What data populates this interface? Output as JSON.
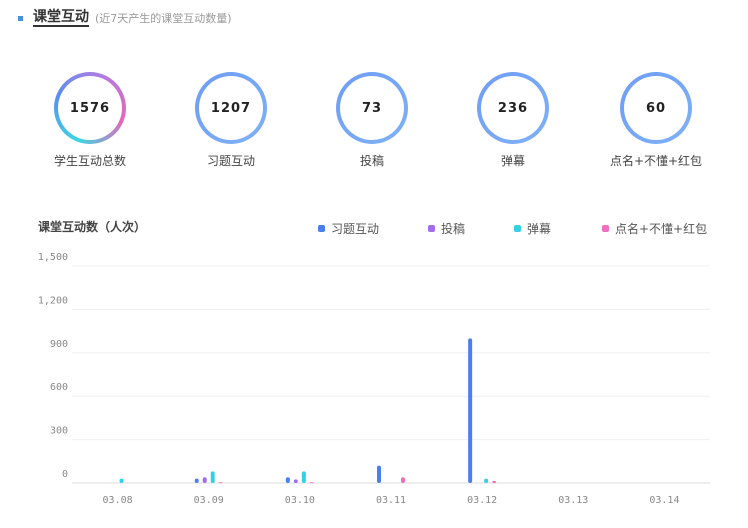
{
  "header": {
    "title": "课堂互动",
    "subtitle": "(近7天产生的课堂互动数量)"
  },
  "stats": [
    {
      "value": "1576",
      "label": "学生互动总数"
    },
    {
      "value": "1207",
      "label": "习题互动"
    },
    {
      "value": "73",
      "label": "投稿"
    },
    {
      "value": "236",
      "label": "弹幕"
    },
    {
      "value": "60",
      "label": "点名+不懂+红包"
    }
  ],
  "chart_data": {
    "type": "bar",
    "title": "课堂互动数（人次）",
    "categories": [
      "03.08",
      "03.09",
      "03.10",
      "03.11",
      "03.12",
      "03.13",
      "03.14"
    ],
    "y_ticks": [
      "1,500",
      "1,200",
      "900",
      "600",
      "300",
      "0"
    ],
    "ylim": [
      0,
      1500
    ],
    "grid": true,
    "legend_position": "top-right",
    "series": [
      {
        "name": "习题互动",
        "color": "#4a7ff0",
        "values": [
          0,
          30,
          40,
          120,
          1000,
          0,
          0
        ]
      },
      {
        "name": "投稿",
        "color": "#a36cf0",
        "values": [
          0,
          40,
          25,
          0,
          0,
          0,
          0
        ]
      },
      {
        "name": "弹幕",
        "color": "#33d1e6",
        "values": [
          30,
          80,
          80,
          0,
          30,
          0,
          0
        ]
      },
      {
        "name": "点名+不懂+红包",
        "color": "#f06ec0",
        "values": [
          0,
          5,
          5,
          40,
          15,
          0,
          0
        ]
      }
    ]
  }
}
